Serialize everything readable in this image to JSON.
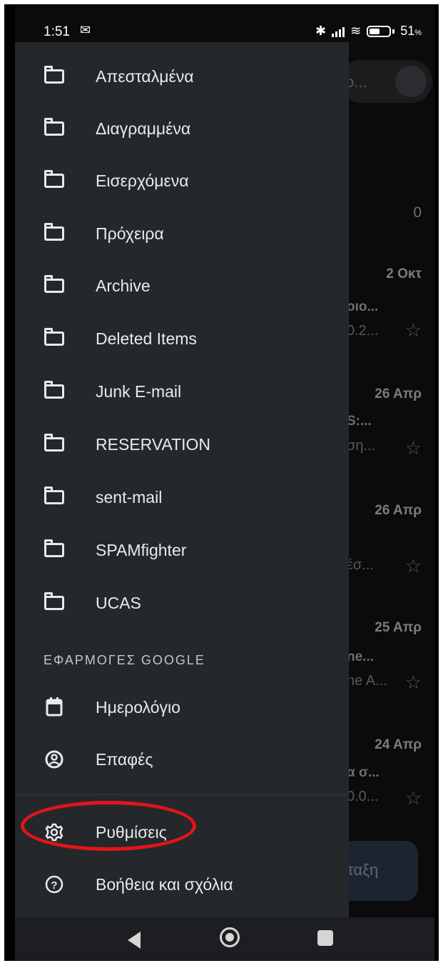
{
  "status_bar": {
    "time": "1:51",
    "battery": "51",
    "battery_unit": "%"
  },
  "drawer": {
    "folders": [
      {
        "label": "Απεσταλμένα",
        "icon": "folder-icon"
      },
      {
        "label": "Διαγραμμένα",
        "icon": "folder-icon"
      },
      {
        "label": "Εισερχόμενα",
        "icon": "folder-icon"
      },
      {
        "label": "Πρόχειρα",
        "icon": "folder-icon"
      },
      {
        "label": "Archive",
        "icon": "folder-icon"
      },
      {
        "label": "Deleted Items",
        "icon": "folder-icon"
      },
      {
        "label": "Junk E-mail",
        "icon": "folder-icon"
      },
      {
        "label": "RESERVATION",
        "icon": "folder-icon"
      },
      {
        "label": "sent-mail",
        "icon": "folder-icon"
      },
      {
        "label": "SPAMfighter",
        "icon": "folder-icon"
      },
      {
        "label": "UCAS",
        "icon": "folder-icon"
      }
    ],
    "google_apps_section": "ΕΦΑΡΜΟΓΕΣ GOOGLE",
    "calendar_label": "Ημερολόγιο",
    "contacts_label": "Επαφές",
    "settings_label": "Ρυθμίσεις",
    "help_label": "Βοήθεια και σχόλια"
  },
  "background_list": {
    "search_text": "ο...",
    "count": "0",
    "rows": [
      {
        "date": "2 Οκτ",
        "subject": "οιο...",
        "snippet": "0.2..."
      },
      {
        "date": "26 Απρ",
        "subject": "S:...",
        "snippet": "ση..."
      },
      {
        "date": "26 Απρ",
        "subject": "",
        "snippet": "έσ..."
      },
      {
        "date": "25 Απρ",
        "subject": "ne...",
        "snippet": "ne A..."
      },
      {
        "date": "24 Απρ",
        "subject": "α σ...",
        "snippet": "0.0..."
      }
    ],
    "compose_label": "νταξη"
  },
  "colors": {
    "drawer_bg": "#25282b",
    "annotation": "#e2141b"
  }
}
